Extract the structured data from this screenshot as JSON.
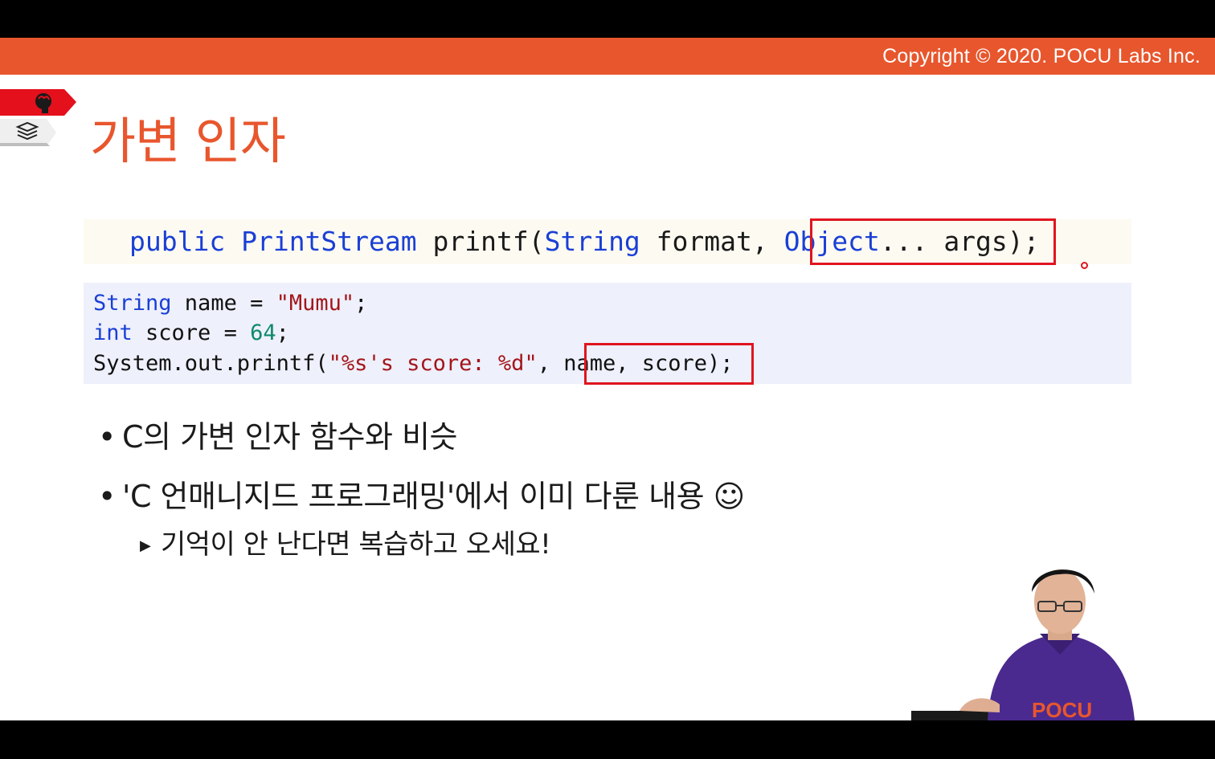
{
  "header": {
    "copyright": "Copyright © 2020. POCU Labs Inc."
  },
  "side_tags": {
    "top_icon": "brain-head-icon",
    "bottom_icon": "stacked-books-icon",
    "top_color": "#e4101c",
    "bottom_color": "#f2f2f2"
  },
  "slide": {
    "title": "가변 인자",
    "signature": {
      "t1": "public",
      "t2": " ",
      "t3": "PrintStream",
      "t4": " printf(",
      "t5": "String",
      "t6": " format, ",
      "t7": "Object",
      "t8": "... args);"
    },
    "code": [
      {
        "t1": "String",
        "t2": " name = ",
        "t3": "\"Mumu\"",
        "t4": ";"
      },
      {
        "t1": "int",
        "t2": " score = ",
        "t3": "64",
        "t4": ";"
      },
      {
        "t1": "System.out.printf(",
        "t2": "\"%s's score: %d\"",
        "t3": ", name, score);"
      }
    ],
    "bullets": [
      "C의 가변 인자 함수와 비슷",
      "'C 언매니지드 프로그래밍'에서 이미 다룬 내용 ☺"
    ],
    "sub_bullets": [
      "기억이 안 난다면 복습하고 오세요!"
    ],
    "shirt_text": "POCU"
  },
  "colors": {
    "accent": "#e8562d",
    "keyword": "#1a3fd6",
    "string": "#a3151a",
    "number": "#0f8a6b",
    "highlight": "#e0141f"
  }
}
